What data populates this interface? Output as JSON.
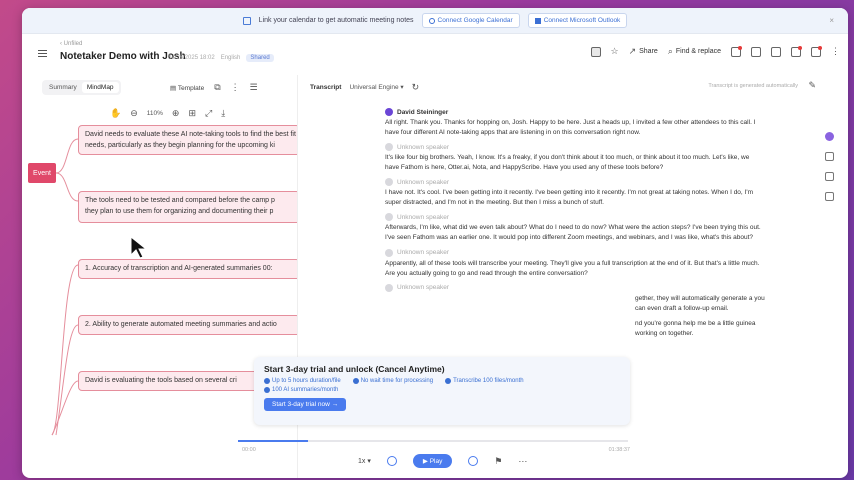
{
  "banner": {
    "message": "Link your calendar to get automatic meeting notes",
    "google_label": "Connect Google Calendar",
    "microsoft_label": "Connect Microsoft Outlook",
    "close": "×"
  },
  "header": {
    "breadcrumb": "Unfiled",
    "title": "Notetaker Demo with Josh",
    "date": "04/26/2025 18:02",
    "language": "English",
    "shared": "Shared",
    "share_label": "Share",
    "find_replace_label": "Find & replace"
  },
  "left": {
    "tabs": [
      "Summary",
      "MindMap"
    ],
    "template_label": "Template",
    "zoom": "110%",
    "root": "Event",
    "nodes": [
      "David needs to evaluate these AI note-taking tools to find the best fit for his",
      "needs, particularly as they begin planning for the upcoming ki",
      "The tools need to be tested and compared before the camp p",
      "they plan to use them for organizing and documenting their p",
      "1. Accuracy of transcription and AI-generated summaries 00:",
      "2. Ability to generate automated meeting summaries and actio",
      "David is evaluating the tools based on several cri"
    ]
  },
  "transcript": {
    "title": "Transcript",
    "engine": "Universal Engine",
    "right_note": "Transcript is generated automatically",
    "entries": [
      {
        "speaker": "David Steininger",
        "text": "All right. Thank you. Thanks for hopping on, Josh. Happy to be here. Just a heads up, I invited a few other attendees to this call. I have four different AI note-taking apps that are listening in on this conversation right now."
      },
      {
        "speaker": "Unknown speaker",
        "text": "It's like four big brothers. Yeah, I know. It's a freaky, if you don't think about it too much, or think about it too much. Let's like, we have Fathom is here, Otter.ai, Nota, and HappyScribe. Have you used any of these tools before?"
      },
      {
        "speaker": "Unknown speaker",
        "text": "I have not. It's cool. I've been getting into it recently. I've been getting into it recently. I'm not great at taking notes. When I do, I'm super distracted, and I'm not in the meeting. But then I miss a bunch of stuff."
      },
      {
        "speaker": "Unknown speaker",
        "text": "Afterwards, I'm like, what did we even talk about? What do I need to do now? What were the action steps? I've been trying this out. I've seen Fathom was an earlier one. It would pop into different Zoom meetings, and webinars, and I was like, what's this about?"
      },
      {
        "speaker": "Unknown speaker",
        "text": "Apparently, all of these tools will transcribe your meeting. They'll give you a full transcription at the end of it. But that's a little much. Are you actually going to go and read through the entire conversation?"
      },
      {
        "speaker": "Unknown speaker",
        "text": "gether, they will automatically generate a you can even draft a follow-up email."
      },
      {
        "speaker": "",
        "text": "nd you're gonna help me be a little guinea working on together."
      }
    ]
  },
  "promo": {
    "title": "Start 3-day trial and unlock (Cancel Anytime)",
    "features": [
      "Up to 5 hours duration/file",
      "No wait time for processing",
      "Transcribe 100 files/month",
      "100 AI summaries/month"
    ],
    "cta": "Start 3-day trial now"
  },
  "player": {
    "time_start": "00:00",
    "time_end": "01:38:37",
    "speed": "1x",
    "play_label": "Play",
    "progress_percent": 18
  },
  "colors": {
    "accent": "#4a7bee",
    "node_fill": "#fdeaee",
    "node_border": "#e58e9c",
    "root": "#e0486a"
  }
}
